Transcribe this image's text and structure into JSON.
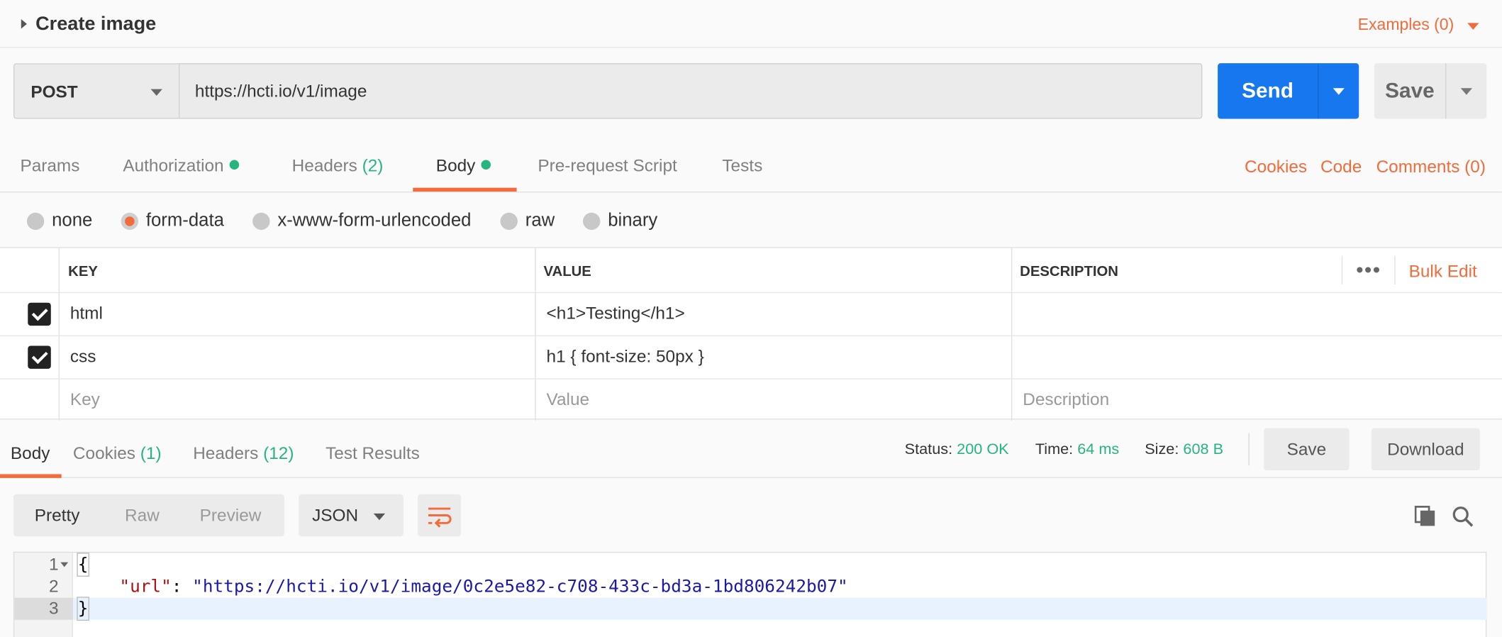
{
  "header": {
    "title": "Create image",
    "examples": "Examples (0)"
  },
  "request": {
    "method": "POST",
    "url": "https://hcti.io/v1/image",
    "send_label": "Send",
    "save_label": "Save"
  },
  "tabs": [
    {
      "label": "Params"
    },
    {
      "label": "Authorization"
    },
    {
      "label": "Headers",
      "count": "(2)"
    },
    {
      "label": "Body"
    },
    {
      "label": "Pre-request Script"
    },
    {
      "label": "Tests"
    }
  ],
  "right_links": {
    "cookies": "Cookies",
    "code": "Code",
    "comments": "Comments (0)"
  },
  "body_types": [
    "none",
    "form-data",
    "x-www-form-urlencoded",
    "raw",
    "binary"
  ],
  "selected_body_type": "form-data",
  "table": {
    "headers": {
      "key": "KEY",
      "value": "VALUE",
      "description": "DESCRIPTION"
    },
    "more": "•••",
    "bulk_edit": "Bulk Edit",
    "rows": [
      {
        "checked": true,
        "key": "html",
        "value": "<h1>Testing</h1>",
        "description": ""
      },
      {
        "checked": true,
        "key": "css",
        "value": "h1 { font-size: 50px }",
        "description": ""
      }
    ],
    "placeholders": {
      "key": "Key",
      "value": "Value",
      "description": "Description"
    }
  },
  "response": {
    "tabs": [
      {
        "label": "Body"
      },
      {
        "label": "Cookies",
        "count": "(1)"
      },
      {
        "label": "Headers",
        "count": "(12)"
      },
      {
        "label": "Test Results"
      }
    ],
    "status_label": "Status:",
    "status_value": "200 OK",
    "time_label": "Time:",
    "time_value": "64 ms",
    "size_label": "Size:",
    "size_value": "608 B",
    "save_label": "Save",
    "download_label": "Download",
    "views": [
      "Pretty",
      "Raw",
      "Preview"
    ],
    "format": "JSON",
    "code": {
      "line1": "{",
      "key": "\"url\"",
      "colon": ": ",
      "value": "\"https://hcti.io/v1/image/0c2e5e82-c708-433c-bd3a-1bd806242b07\"",
      "line3": "}"
    },
    "line_numbers": [
      "1",
      "2",
      "3"
    ]
  },
  "colors": {
    "accent": "#f26b3a",
    "primary": "#1677ee",
    "success": "#26b47f"
  },
  "icons": [
    "caret-right-icon",
    "chevron-down-icon",
    "more-icon",
    "wrap-icon",
    "copy-icon",
    "search-icon"
  ]
}
